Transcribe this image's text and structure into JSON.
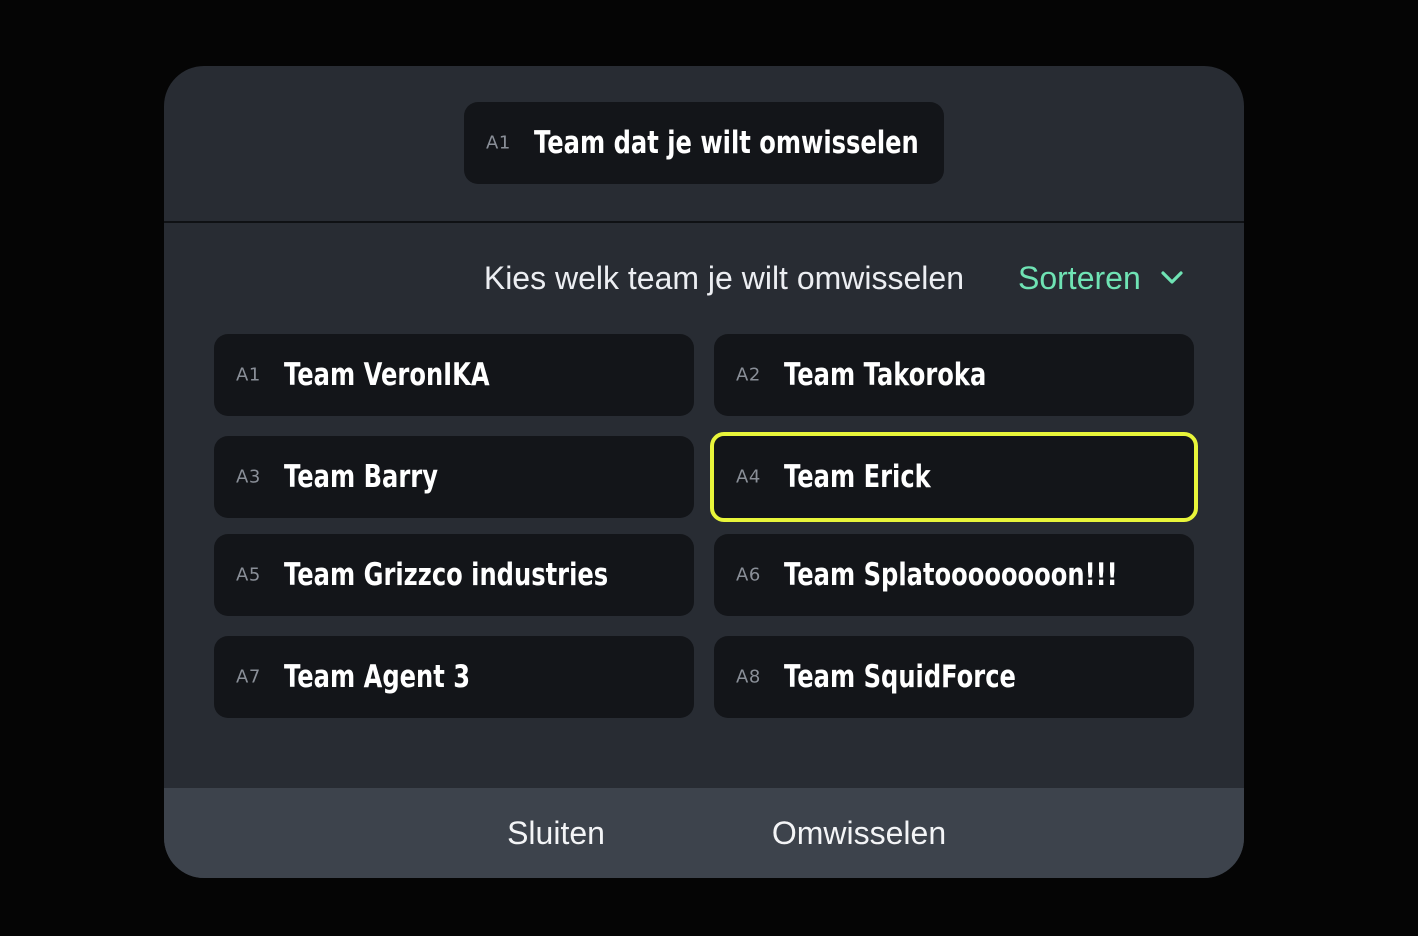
{
  "header": {
    "selected_slot": {
      "seed": "A1",
      "name": "Team dat je wilt omwisselen"
    }
  },
  "prompt": {
    "text": "Kies welk team je wilt omwisselen",
    "sort_label": "Sorteren",
    "sort_icon": "chevron-down-icon"
  },
  "teams": [
    {
      "seed": "A1",
      "name": "Team VeronIKA",
      "selected": false
    },
    {
      "seed": "A2",
      "name": "Team Takoroka",
      "selected": false
    },
    {
      "seed": "A3",
      "name": "Team Barry",
      "selected": false
    },
    {
      "seed": "A4",
      "name": "Team Erick",
      "selected": true
    },
    {
      "seed": "A5",
      "name": "Team Grizzco industries",
      "selected": false
    },
    {
      "seed": "A6",
      "name": "Team Splatoooooooon!!!",
      "selected": false
    },
    {
      "seed": "A7",
      "name": "Team Agent 3",
      "selected": false
    },
    {
      "seed": "A8",
      "name": "Team SquidForce",
      "selected": false
    }
  ],
  "footer": {
    "close_label": "Sluiten",
    "swap_label": "Omwisselen"
  },
  "colors": {
    "background": "#050505",
    "modal": "#282c33",
    "slot": "#131519",
    "selected_border": "#e8f53a",
    "accent": "#6fe3b4",
    "footer": "#3d434c"
  }
}
